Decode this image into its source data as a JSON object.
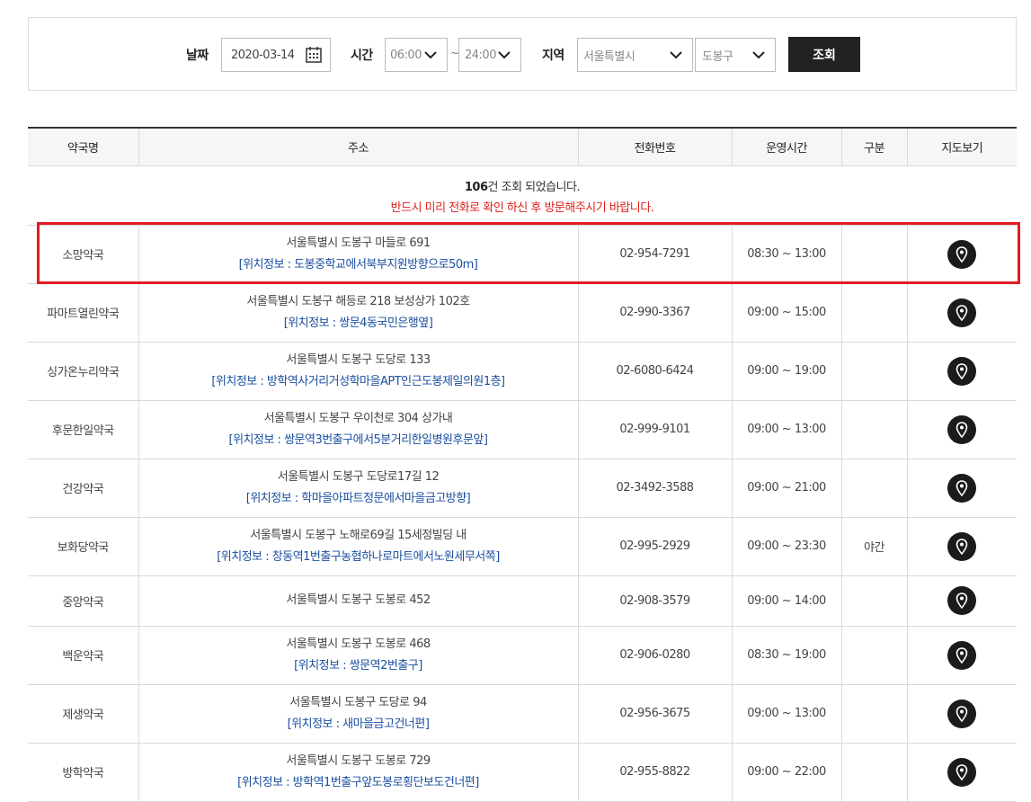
{
  "search": {
    "date_label": "날짜",
    "date_value": "2020-03-14",
    "time_label": "시간",
    "time_start": "06:00",
    "time_separator": "~",
    "time_end": "24:00",
    "region_label": "지역",
    "region_city": "서울특별시",
    "region_district": "도봉구",
    "search_button": "조회"
  },
  "table": {
    "headers": [
      "약국명",
      "주소",
      "전화번호",
      "운영시간",
      "구분",
      "지도보기"
    ],
    "count_number": "106",
    "count_suffix": "건 조회 되었습니다.",
    "warning": "반드시 미리 전화로 확인 하신 후 방문해주시기 바랍니다.",
    "rows": [
      {
        "name": "소망약국",
        "address": "서울특별시 도봉구 마들로 691",
        "location": "[위치정보 : 도봉중학교에서북부지원방향으로50m]",
        "phone": "02-954-7291",
        "hours": "08:30 ~ 13:00",
        "type": ""
      },
      {
        "name": "파마트열린약국",
        "address": "서울특별시 도봉구 해등로 218 보성상가 102호",
        "location": "[위치정보 : 쌍문4동국민은행옆]",
        "phone": "02-990-3367",
        "hours": "09:00 ~ 15:00",
        "type": ""
      },
      {
        "name": "싱가온누리약국",
        "address": "서울특별시 도봉구 도당로 133",
        "location": "[위치정보 : 방학역사거리거성학마을APT인근도봉제일의원1층]",
        "phone": "02-6080-6424",
        "hours": "09:00 ~ 19:00",
        "type": ""
      },
      {
        "name": "후문한일약국",
        "address": "서울특별시 도봉구 우이천로 304 상가내",
        "location": "[위치정보 : 쌍문역3번출구에서5분거리한일병원후문앞]",
        "phone": "02-999-9101",
        "hours": "09:00 ~ 13:00",
        "type": ""
      },
      {
        "name": "건강약국",
        "address": "서울특별시 도봉구 도당로17길 12",
        "location": "[위치정보 : 학마을아파트정문에서마을금고방향]",
        "phone": "02-3492-3588",
        "hours": "09:00 ~ 21:00",
        "type": ""
      },
      {
        "name": "보화당약국",
        "address": "서울특별시 도봉구 노해로69길 15세정빌딩 내",
        "location": "[위치정보 : 창동역1번출구농협하나로마트에서노원세무서쪽]",
        "phone": "02-995-2929",
        "hours": "09:00 ~ 23:30",
        "type": "야간"
      },
      {
        "name": "중앙약국",
        "address": "서울특별시 도봉구 도봉로 452",
        "location": "",
        "phone": "02-908-3579",
        "hours": "09:00 ~ 14:00",
        "type": ""
      },
      {
        "name": "백운약국",
        "address": "서울특별시 도봉구 도봉로 468",
        "location": "[위치정보 : 쌍문역2번출구]",
        "phone": "02-906-0280",
        "hours": "08:30 ~ 19:00",
        "type": ""
      },
      {
        "name": "제생약국",
        "address": "서울특별시 도봉구 도당로 94",
        "location": "[위치정보 : 새마을금고건너편]",
        "phone": "02-956-3675",
        "hours": "09:00 ~ 13:00",
        "type": ""
      },
      {
        "name": "방학약국",
        "address": "서울특별시 도봉구 도봉로 729",
        "location": "[위치정보 : 방학역1번출구앞도봉로횡단보도건너편]",
        "phone": "02-955-8822",
        "hours": "09:00 ~ 22:00",
        "type": ""
      }
    ]
  },
  "colors": {
    "accent_dark": "#222222",
    "location_text": "#1a4fa0",
    "warning_text": "#e0201a",
    "highlight_border": "#e31b23"
  },
  "icons": {
    "calendar": "calendar-icon",
    "dropdown": "chevron-down-icon",
    "map": "map-pin-icon"
  }
}
